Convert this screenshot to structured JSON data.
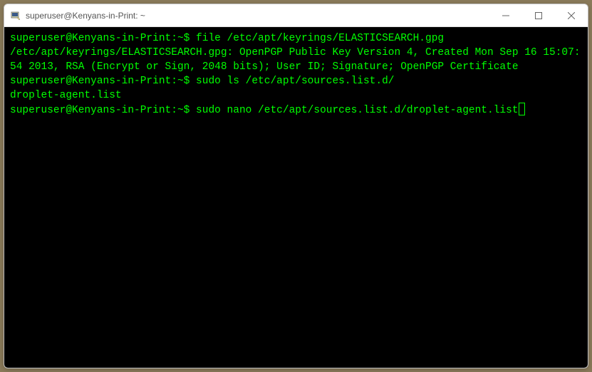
{
  "titlebar": {
    "title": "superuser@Kenyans-in-Print: ~",
    "icon_name": "putty-icon"
  },
  "terminal": {
    "prompt": "superuser@Kenyans-in-Print:~$",
    "lines": [
      {
        "type": "cmd",
        "prompt": "superuser@Kenyans-in-Print:~$",
        "text": " file /etc/apt/keyrings/ELASTICSEARCH.gpg"
      },
      {
        "type": "out",
        "text": "/etc/apt/keyrings/ELASTICSEARCH.gpg: OpenPGP Public Key Version 4, Created Mon Sep 16 15:07:54 2013, RSA (Encrypt or Sign, 2048 bits); User ID; Signature; OpenPGP Certificate"
      },
      {
        "type": "cmd",
        "prompt": "superuser@Kenyans-in-Print:~$",
        "text": " sudo ls /etc/apt/sources.list.d/"
      },
      {
        "type": "out",
        "text": "droplet-agent.list"
      },
      {
        "type": "cmd",
        "prompt": "superuser@Kenyans-in-Print:~$",
        "text": " sudo nano /etc/apt/sources.list.d/droplet-agent.list"
      }
    ]
  }
}
